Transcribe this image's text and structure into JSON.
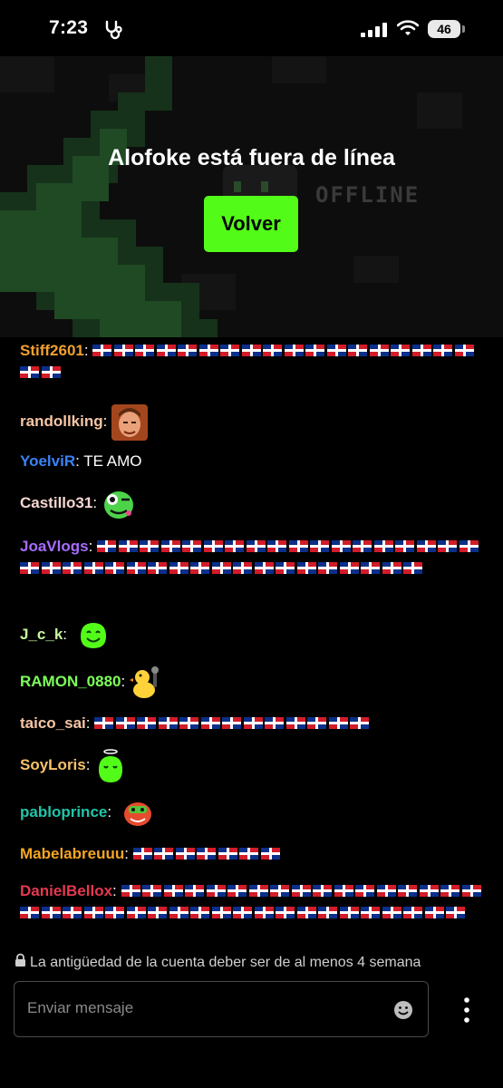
{
  "status_bar": {
    "time": "7:23",
    "battery": "46"
  },
  "hero": {
    "title": "Alofoke está fuera de línea",
    "offline_label": "OFFLINE",
    "button_label": "Volver"
  },
  "chat": {
    "messages": [
      {
        "user": "Stiff2601",
        "color": "#f0a030",
        "content": "flags",
        "flag_count": 20
      },
      {
        "user": "randollking",
        "color": "#f5c6a5",
        "content": "emote",
        "emote": "man-face-emote"
      },
      {
        "user": "YoelviR",
        "color": "#3b82f6",
        "content": "text",
        "text": "TE AMO"
      },
      {
        "user": "Castillo31",
        "color": "#f5d6cf",
        "content": "emote",
        "emote": "winking-frog-emote"
      },
      {
        "user": "JoaVlogs",
        "color": "#a66cff",
        "content": "flags",
        "flag_count": 37
      },
      {
        "user": "J_c_k",
        "color": "#c6f6a0",
        "content": "emote",
        "emote": "green-smile-emote"
      },
      {
        "user": "RAMON_0880",
        "color": "#7dff5a",
        "content": "emote",
        "emote": "duck-microphone-emote"
      },
      {
        "user": "taico_sai",
        "color": "#f5c6a5",
        "content": "flags",
        "flag_count": 13
      },
      {
        "user": "SoyLoris",
        "color": "#f5c26b",
        "content": "emote",
        "emote": "green-angel-emote"
      },
      {
        "user": "pabloprince",
        "color": "#22c4a8",
        "content": "emote",
        "emote": "red-face-emote"
      },
      {
        "user": "Mabelabreuuu",
        "color": "#f5a623",
        "content": "flags",
        "flag_count": 7
      },
      {
        "user": "DanielBellox",
        "color": "#e53950",
        "content": "flags",
        "flag_count": 38
      }
    ]
  },
  "composer": {
    "notice": "La antigüedad de la cuenta deber ser de al menos 4 semana",
    "placeholder": "Enviar mensaje"
  }
}
